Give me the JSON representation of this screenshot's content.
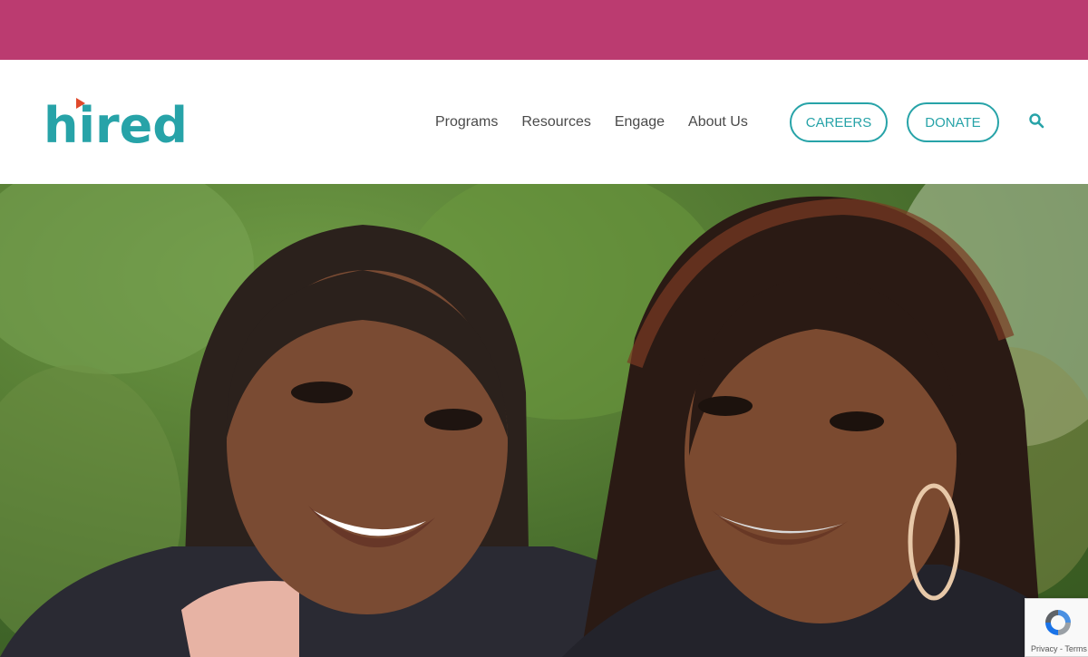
{
  "colors": {
    "band": "#bb3b70",
    "brand_teal": "#27a3a8",
    "logo_accent": "#e0492b"
  },
  "logo": {
    "text": "hired"
  },
  "nav": {
    "items": [
      {
        "label": "Programs"
      },
      {
        "label": "Resources"
      },
      {
        "label": "Engage"
      },
      {
        "label": "About Us"
      }
    ]
  },
  "buttons": {
    "careers": "CAREERS",
    "donate": "DONATE"
  },
  "icons": {
    "search": "search-icon",
    "recaptcha": "recaptcha-icon"
  },
  "hero": {
    "alt": "Two smiling women with braided hair outdoors"
  },
  "recaptcha": {
    "privacy": "Privacy",
    "separator": " - ",
    "terms": "Terms"
  }
}
